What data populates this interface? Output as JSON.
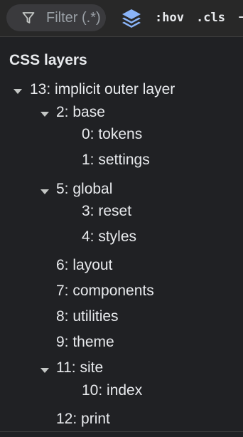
{
  "toolbar": {
    "filter_text": "Filter (.*)",
    "hov_label": ":hov",
    "cls_label": ".cls",
    "add_label": "+"
  },
  "panel": {
    "title": "CSS layers",
    "layers": [
      {
        "label": "13: implicit outer layer",
        "expanded": true
      },
      {
        "label": "2: base",
        "expanded": true
      },
      {
        "label": "0: tokens"
      },
      {
        "label": "1: settings"
      },
      {
        "label": "5: global",
        "expanded": true
      },
      {
        "label": "3: reset"
      },
      {
        "label": "4: styles"
      },
      {
        "label": "6: layout"
      },
      {
        "label": "7: components"
      },
      {
        "label": "8: utilities"
      },
      {
        "label": "9: theme"
      },
      {
        "label": "11: site",
        "expanded": true
      },
      {
        "label": "10: index"
      },
      {
        "label": "12: print"
      }
    ]
  }
}
